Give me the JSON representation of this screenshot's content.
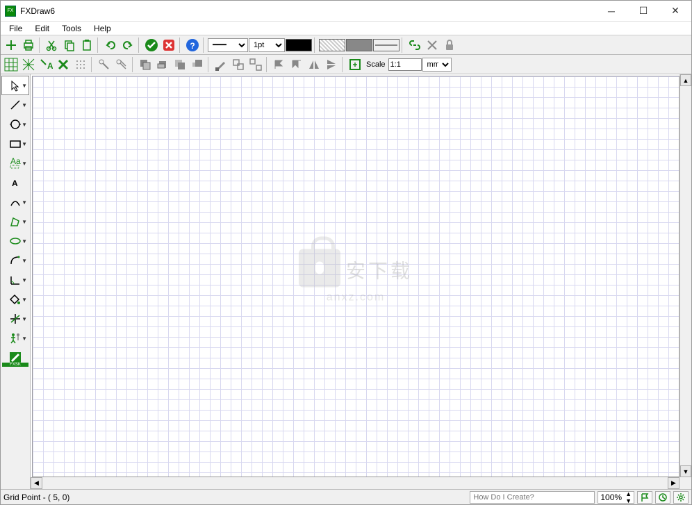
{
  "titlebar": {
    "title": "FXDraw6"
  },
  "menubar": {
    "items": [
      "File",
      "Edit",
      "Tools",
      "Help"
    ]
  },
  "toolbar1": {
    "line_width": "1pt",
    "fill_color": "#000000",
    "line_color": "#0060ff"
  },
  "toolbar2": {
    "scale_label": "Scale",
    "scale_value": "1:1",
    "scale_unit": "mm"
  },
  "watermark": {
    "line1": "安下载",
    "line2": "anxz.com"
  },
  "statusbar": {
    "text": "Grid Point - ( 5, 0)",
    "search_placeholder": "How Do I Create?",
    "zoom": "100%"
  },
  "left_tools": [
    {
      "name": "pointer-tool",
      "dd": true,
      "selected": true
    },
    {
      "name": "line-tool",
      "dd": true
    },
    {
      "name": "circle-tool",
      "dd": true
    },
    {
      "name": "rectangle-tool",
      "dd": true
    },
    {
      "name": "text-annotation-tool",
      "dd": true
    },
    {
      "name": "text-tool",
      "dd": false
    },
    {
      "name": "curve-tool",
      "dd": true
    },
    {
      "name": "polygon-tool",
      "dd": true
    },
    {
      "name": "ellipse-tool",
      "dd": true
    },
    {
      "name": "arc-tool",
      "dd": true
    },
    {
      "name": "angle-tool",
      "dd": true
    },
    {
      "name": "fill-tool",
      "dd": true
    },
    {
      "name": "axes-tool",
      "dd": true
    },
    {
      "name": "figure-tool",
      "dd": true
    },
    {
      "name": "fxsk-tool",
      "dd": false
    }
  ]
}
